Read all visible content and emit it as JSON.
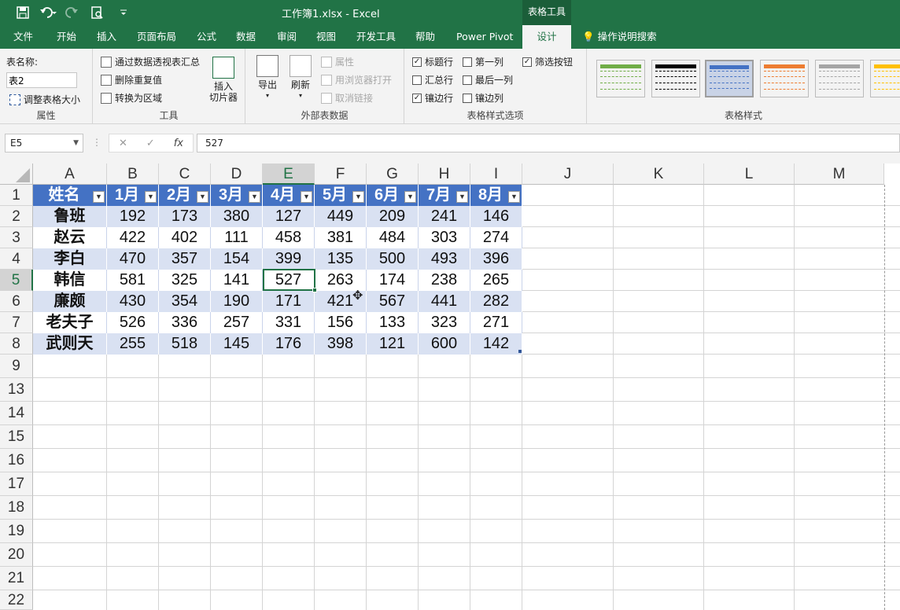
{
  "title": {
    "doc": "工作簿1.xlsx  -  Excel",
    "tools": "表格工具"
  },
  "tabs": [
    "文件",
    "开始",
    "插入",
    "页面布局",
    "公式",
    "数据",
    "审阅",
    "视图",
    "开发工具",
    "帮助",
    "Power Pivot",
    "设计"
  ],
  "tell_me": "操作说明搜索",
  "ribbon": {
    "props": {
      "label": "表名称:",
      "table_name": "表2",
      "resize": "调整表格大小",
      "group": "属性"
    },
    "tools": {
      "pivot": "通过数据透视表汇总",
      "dedupe": "删除重复值",
      "convert": "转换为区域",
      "slicer_a": "插入",
      "slicer_b": "切片器",
      "group": "工具"
    },
    "external": {
      "export": "导出",
      "refresh": "刷新",
      "properties": "属性",
      "open_browser": "用浏览器打开",
      "unlink": "取消链接",
      "group": "外部表数据"
    },
    "style_options": {
      "header_row": "标题行",
      "total_row": "汇总行",
      "banded_rows": "镶边行",
      "first_col": "第一列",
      "last_col": "最后一列",
      "banded_cols": "镶边列",
      "filter_btn": "筛选按钮",
      "group": "表格样式选项"
    },
    "styles": {
      "group": "表格样式",
      "swatches": [
        "#70ad47",
        "#000000",
        "#4472c4",
        "#ed7d31",
        "#a5a5a5",
        "#ffc000"
      ]
    }
  },
  "formula_bar": {
    "name_box": "E5",
    "cancel": "✕",
    "enter": "✓",
    "fx": "fx",
    "value": "527"
  },
  "columns": [
    "A",
    "B",
    "C",
    "D",
    "E",
    "F",
    "G",
    "H",
    "I",
    "J",
    "K",
    "L",
    "M"
  ],
  "rows": [
    "1",
    "2",
    "3",
    "4",
    "5",
    "6",
    "7",
    "8",
    "9",
    "13",
    "14",
    "15",
    "16",
    "17",
    "18",
    "19",
    "20",
    "21",
    "22"
  ],
  "table": {
    "headers": [
      "姓名",
      "1月",
      "2月",
      "3月",
      "4月",
      "5月",
      "6月",
      "7月",
      "8月"
    ],
    "data": [
      [
        "鲁班",
        "192",
        "173",
        "380",
        "127",
        "449",
        "209",
        "241",
        "146"
      ],
      [
        "赵云",
        "422",
        "402",
        "111",
        "458",
        "381",
        "484",
        "303",
        "274"
      ],
      [
        "李白",
        "470",
        "357",
        "154",
        "399",
        "135",
        "500",
        "493",
        "396"
      ],
      [
        "韩信",
        "581",
        "325",
        "141",
        "527",
        "263",
        "174",
        "238",
        "265"
      ],
      [
        "廉颇",
        "430",
        "354",
        "190",
        "171",
        "421",
        "567",
        "441",
        "282"
      ],
      [
        "老夫子",
        "526",
        "336",
        "257",
        "331",
        "156",
        "133",
        "323",
        "271"
      ],
      [
        "武则天",
        "255",
        "518",
        "145",
        "176",
        "398",
        "121",
        "600",
        "142"
      ]
    ]
  }
}
